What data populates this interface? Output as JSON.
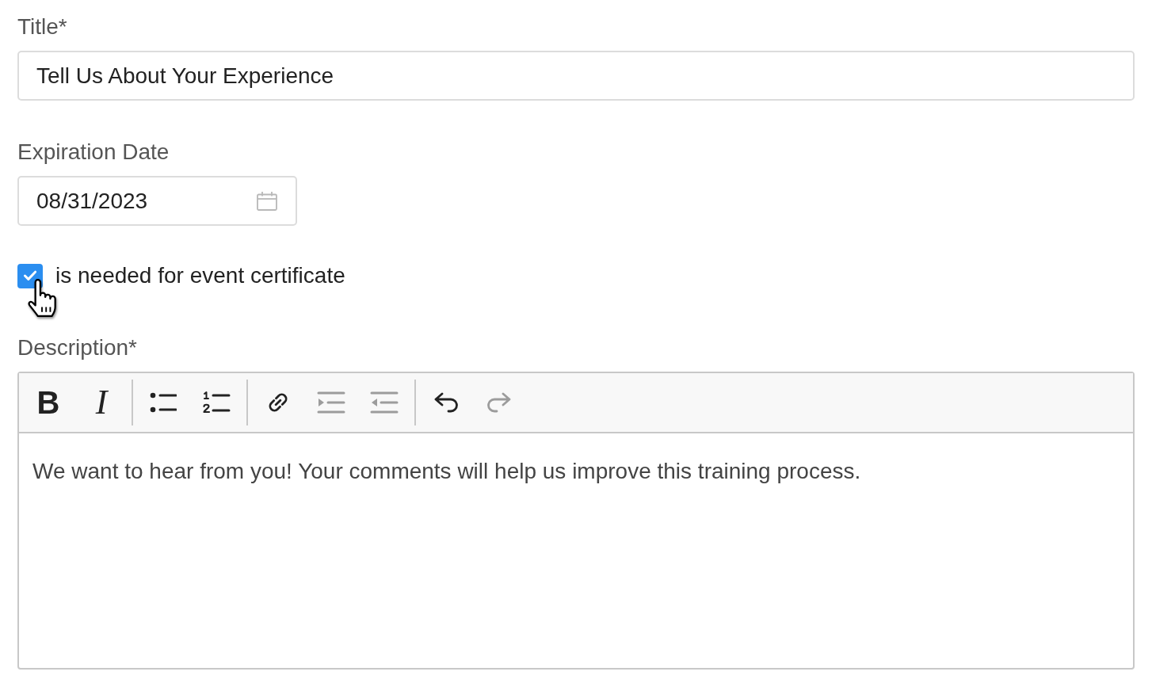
{
  "title_field": {
    "label": "Title*",
    "value": "Tell Us About Your Experience"
  },
  "expiration_date": {
    "label": "Expiration Date",
    "value": "08/31/2023"
  },
  "certificate_checkbox": {
    "label": "is needed for event certificate",
    "checked": true
  },
  "description": {
    "label": "Description*",
    "toolbar": [
      {
        "tools": [
          {
            "kind": "bold",
            "label": "B",
            "disabled": false
          },
          {
            "kind": "italic",
            "label": "I",
            "disabled": false
          }
        ]
      },
      {
        "tools": [
          {
            "kind": "bullet_list",
            "disabled": false
          },
          {
            "kind": "numbered_list",
            "disabled": false
          }
        ]
      },
      {
        "tools": [
          {
            "kind": "link",
            "disabled": false
          },
          {
            "kind": "indent",
            "disabled": true
          },
          {
            "kind": "outdent",
            "disabled": true
          }
        ]
      },
      {
        "tools": [
          {
            "kind": "undo",
            "disabled": false
          },
          {
            "kind": "redo",
            "disabled": true
          }
        ]
      }
    ],
    "content": "We want to hear from you! Your comments will help us improve this training process."
  }
}
